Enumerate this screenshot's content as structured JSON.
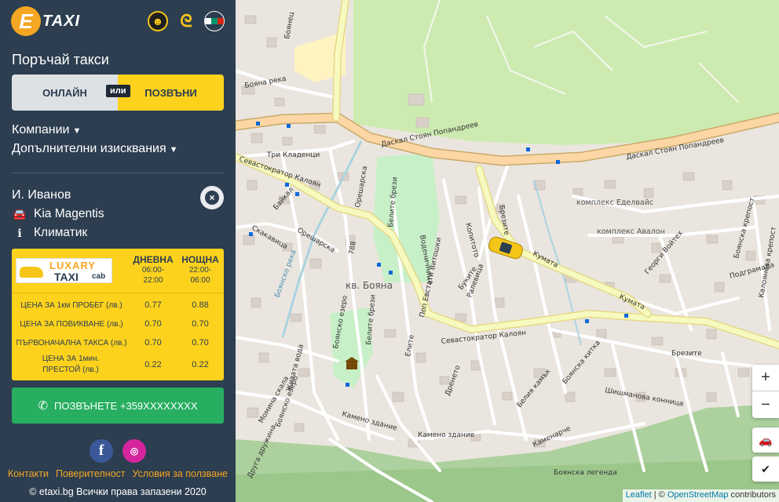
{
  "brand": {
    "logo_letter": "E",
    "logo_text": "TAXI"
  },
  "header": {
    "flag_colors": [
      "#ffffff",
      "#00966e",
      "#d62612"
    ]
  },
  "order": {
    "title": "Поръчай такси",
    "online_label": "ОНЛАЙН",
    "or_label": "или",
    "call_label": "ПОЗВЪНИ"
  },
  "filters": {
    "companies_label": "Компании",
    "extra_label": "Допълнителни изисквания"
  },
  "driver": {
    "name": "И. Иванов",
    "car": "Kia Magentis",
    "feature": "Климатик"
  },
  "tariff": {
    "company_logo": {
      "line1": "LUXARY",
      "line2": "TAXI",
      "line3": "cab"
    },
    "day": {
      "name": "ДНЕВНА",
      "time_from": "06:00-",
      "time_to": "22:00"
    },
    "night": {
      "name": "НОЩНА",
      "time_from": "22:00-",
      "time_to": "06:00"
    },
    "rows": [
      {
        "label": "ЦЕНА ЗА 1км ПРОБЕГ (лв.)",
        "day": "0.77",
        "night": "0.88"
      },
      {
        "label": "ЦЕНА ЗА ПОВИКВАНЕ (лв.)",
        "day": "0.70",
        "night": "0.70"
      },
      {
        "label": "ПЪРВОНАЧАЛНА ТАКСА (лв.)",
        "day": "0.70",
        "night": "0.70"
      },
      {
        "label": "ЦЕНА ЗА 1мин. ПРЕСТОЙ (лв.)",
        "day": "0.22",
        "night": "0.22"
      }
    ]
  },
  "call_button": {
    "label": "ПОЗВЪНЕТЕ +359XXXXXXXX"
  },
  "footer": {
    "links": [
      "Контакти",
      "Поверителност",
      "Условия за ползване"
    ],
    "copyright": "© etaxi.bg Всички права запазени 2020"
  },
  "map": {
    "labels": {
      "dsp1": "Даскал Стоян Попандреев",
      "dsp2": "Даскал Стоян Попандреев",
      "boyana": "кв. Бояна",
      "sevast": "Севастократор Калоян",
      "kalojan": "Севастократор Калоян",
      "kumata1": "Кумата",
      "kumata2": "Кумата",
      "edelvais": "комплекс Еделвайс",
      "avalon": "комплекс Авалон",
      "tri": "Три Кладенци",
      "boyanska_reka": "Бояна река",
      "boyansko_reka": "Боянско река",
      "bajkal": "Байкал",
      "oreshar": "Орешарска",
      "oreshar2": "Орешарска",
      "skakav": "Скакавица",
      "belite": "Белите брези",
      "belite2": "Белите брези",
      "vodenich": "Воденичница",
      "vitoshki": "Поп Евстати Витошки",
      "bukite": "Буките",
      "kopito": "Копитото",
      "ralevica": "Ралевица",
      "brezite": "Брезите",
      "brezite2": "Брезите",
      "elite": "Елите",
      "drenoto": "Дренето",
      "boyansko_ezero": "Боянско езеро",
      "boyansko_ezero2": "Боянско езеро",
      "zhivata": "Живата вода",
      "momina": "Момина скала",
      "kameno": "Камено здание",
      "kameno2": "Камено здание",
      "kamenarche": "Каменарче",
      "belia": "Белия камък",
      "boyanska_kitka": "Боянска китка",
      "shishmanova": "Шишманова конница",
      "boyanska_legenda": "Боянска легенда",
      "boyanska_krepost": "Боянска крепост",
      "kalojanova": "Калоянова крепост",
      "podgramada": "Подграмада",
      "georgi": "Георги Войтех",
      "n788": "788",
      "drujina": "Друга дружина",
      "boyanets": "Боянец"
    },
    "zoom_in": "+",
    "zoom_out": "−",
    "attribution_leaflet": "Leaflet",
    "attribution_sep": " | © ",
    "attribution_osm": "OpenStreetMap",
    "attribution_rest": " contributors"
  }
}
